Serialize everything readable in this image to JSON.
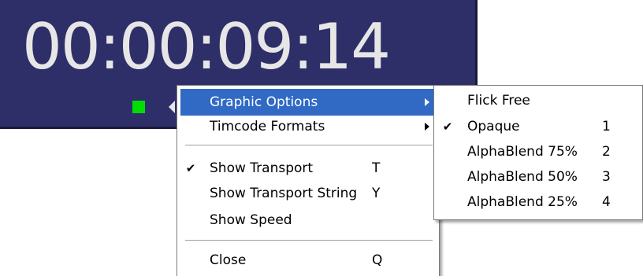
{
  "timecode": {
    "display": "00:00:09:14",
    "background": "#2e2e68",
    "text_color": "#e6e6e6",
    "led_color": "#00dd00"
  },
  "context_menu": {
    "items": [
      {
        "label": "Graphic Options",
        "has_submenu": true,
        "highlighted": true
      },
      {
        "label": "Timcode Formats",
        "has_submenu": true
      },
      {
        "label": "Show Transport",
        "shortcut": "T",
        "checked": true
      },
      {
        "label": "Show Transport String",
        "shortcut": "Y"
      },
      {
        "label": "Show Speed"
      },
      {
        "label": "Close",
        "shortcut": "Q"
      }
    ],
    "highlight_color": "#316ac5"
  },
  "submenu": {
    "items": [
      {
        "label": "Flick Free"
      },
      {
        "label": "Opaque",
        "shortcut": "1",
        "checked": true
      },
      {
        "label": "AlphaBlend 75%",
        "shortcut": "2"
      },
      {
        "label": "AlphaBlend 50%",
        "shortcut": "3"
      },
      {
        "label": "AlphaBlend 25%",
        "shortcut": "4"
      }
    ]
  },
  "glyphs": {
    "check": "✔"
  }
}
